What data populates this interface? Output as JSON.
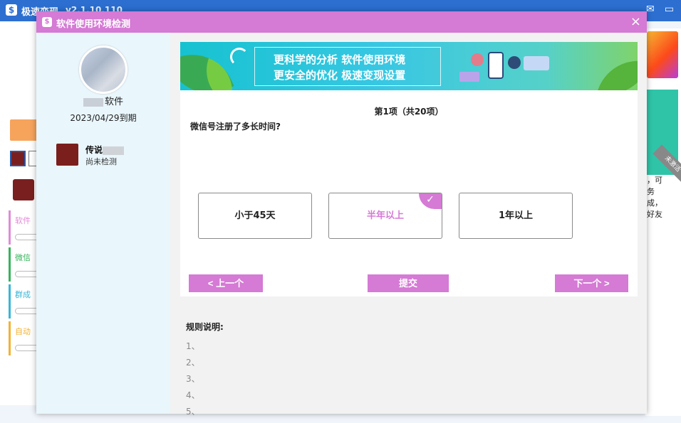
{
  "app": {
    "title": "极速变现",
    "version": "v2.1.10.110",
    "logo_char": "$"
  },
  "bg_sidebar": {
    "items": [
      {
        "label": "软件",
        "color": "#e08bd6"
      },
      {
        "label": "微信",
        "color": "#35b35a"
      },
      {
        "label": "群成",
        "color": "#38b6d6"
      },
      {
        "label": "自动",
        "color": "#f2b233"
      }
    ]
  },
  "bg_right": {
    "ribbon": "未激活",
    "text": [
      "，可",
      "务",
      "成，",
      "好友"
    ]
  },
  "modal": {
    "title": "软件使用环境检测",
    "logo_char": "$",
    "close": "×"
  },
  "profile": {
    "software_suffix": "软件",
    "expire": "2023/04/29到期"
  },
  "wechat_account": {
    "name_prefix": "传说",
    "status": "尚未检测"
  },
  "banner": {
    "line1": "更科学的分析 软件使用环境",
    "line2": "更安全的优化 极速变现设置"
  },
  "quiz": {
    "progress": "第1项（共20项）",
    "question": "微信号注册了多长时间?",
    "options": [
      {
        "label": "小于45天",
        "selected": false
      },
      {
        "label": "半年以上",
        "selected": true
      },
      {
        "label": "1年以上",
        "selected": false
      }
    ],
    "check_mark": "✓",
    "prev_label": "< 上一个",
    "submit_label": "提交",
    "next_label": "下一个 >"
  },
  "rules": {
    "title": "规则说明:",
    "items": [
      "1、",
      "2、",
      "3、",
      "4、",
      "5、"
    ]
  },
  "colors": {
    "accent": "#d57ad5",
    "app_blue": "#2c6fd1"
  }
}
